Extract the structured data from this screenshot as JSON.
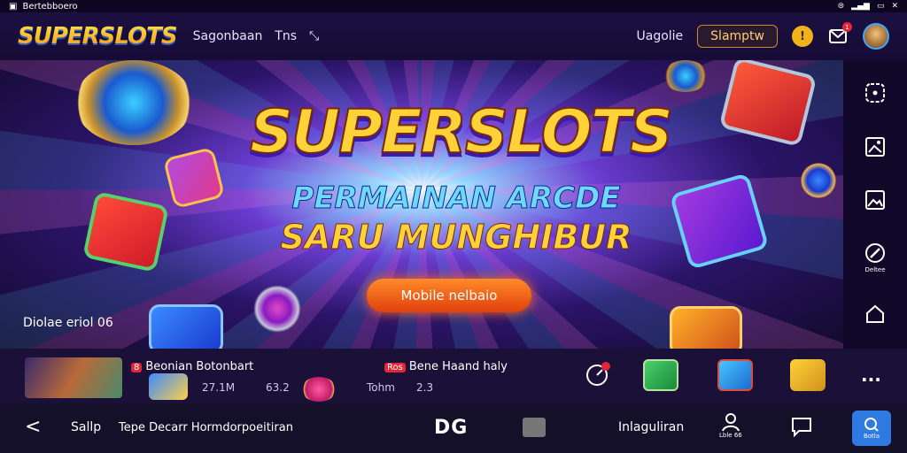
{
  "status_bar": {
    "app_label": "Bertebboero"
  },
  "header": {
    "logo": "SUPERSLOTS",
    "nav": [
      "Sagonbaan",
      "Tns"
    ],
    "login_label": "Uagolie",
    "signup_label": "Slamptw",
    "mail_badge": "1",
    "accent": "#f0b41a"
  },
  "hero": {
    "title": "SUPERSLOTS",
    "subtitle_line1": "PERMAINAN ARCDE",
    "subtitle_line2": "SARU MUNGHIBUR",
    "cta_label": "Mobile nelbaio",
    "caption": "Diolae eriol 06",
    "colors": {
      "title": "#ffd23a",
      "subtitle": "#6fd8ff",
      "cta": "#e1400c"
    }
  },
  "side_rail": {
    "items": [
      {
        "icon": "dice-icon",
        "label": ""
      },
      {
        "icon": "image-icon",
        "label": ""
      },
      {
        "icon": "gallery-icon",
        "label": ""
      },
      {
        "icon": "edit-icon",
        "label": "Deltee"
      },
      {
        "icon": "home-icon",
        "label": ""
      }
    ]
  },
  "games_strip": {
    "game1": {
      "tag": "8",
      "title": "Beonian Botonbart",
      "players": "27.1M",
      "plays": "63.2"
    },
    "game2": {
      "tag": "Ros",
      "title": "Bene Haand haly",
      "players": "Tohm",
      "plays": "2.3"
    },
    "more_label": "..."
  },
  "bottom_bar": {
    "back_label": "<",
    "skip_label": "Sallp",
    "address": "Tepe Decarr Hormdorpoeitiran",
    "center_logo": "DG",
    "messages_label": "Inlaguliran",
    "profile_label": "Lble 66",
    "chat_label": "",
    "primary_label": "Botla"
  }
}
